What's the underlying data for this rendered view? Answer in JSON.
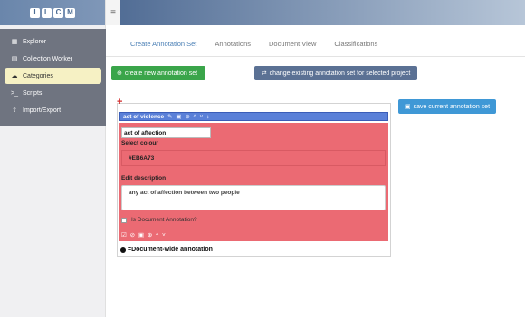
{
  "logo": [
    "I",
    "L",
    "C",
    "M"
  ],
  "sidebar": {
    "items": [
      {
        "label": "Explorer",
        "icon": "table-icon"
      },
      {
        "label": "Collection Worker",
        "icon": "file-icon"
      },
      {
        "label": "Categories",
        "icon": "cloud-icon",
        "active": true
      },
      {
        "label": "Scripts",
        "icon": "terminal-icon"
      },
      {
        "label": "Import/Export",
        "icon": "upload-icon"
      }
    ]
  },
  "topbar": {
    "menu_glyph": "≡"
  },
  "tabs": [
    {
      "label": "Create Annotation Set",
      "active": true
    },
    {
      "label": "Annotations"
    },
    {
      "label": "Document View"
    },
    {
      "label": "Classifications"
    }
  ],
  "buttons": {
    "create": "create new annotation set",
    "change": "change existing annotation set for selected project",
    "save": "save current annotation set"
  },
  "panel": {
    "add_glyph": "+",
    "header": "act of violence",
    "header_tools": "✎ ▣ ⊕ ^ ˅ ↕",
    "name_value": "act of affection",
    "colour_label": "Select colour",
    "colour_value": "#EB6A73",
    "description_label": "Edit description",
    "description_value": "any act of affection between two people",
    "document_annotation_label": "Is Document Annotation?",
    "row_tools": "☑ ⊘ ▣ ⊕ ^ ˅",
    "legend": "=Document-wide annotation"
  },
  "colors": {
    "annotation": "#EB6A73",
    "header": "#5A80D8",
    "create_button": "#3AA54A",
    "save_button": "#3F98D6"
  }
}
